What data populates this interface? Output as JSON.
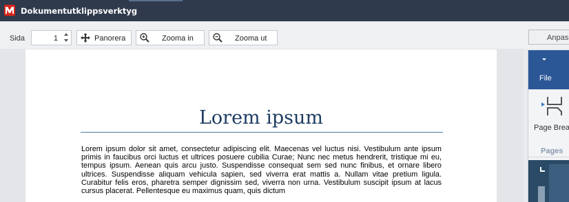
{
  "window": {
    "title": "Dokumentutklippsverktyg",
    "app_icon": "app-logo-icon",
    "accent": "#d9261c",
    "titlebar_color": "#2f3b4d"
  },
  "toolbar": {
    "page_label": "Sida",
    "page_value": "1",
    "pan_label": "Panorera",
    "zoom_in_label": "Zooma in",
    "zoom_out_label": "Zooma ut"
  },
  "document": {
    "title": "Lorem ipsum",
    "paragraph": "Lorem ipsum dolor sit amet, consectetur adipiscing elit. Maecenas vel luctus nisi. Vestibulum ante ipsum primis in faucibus orci luctus et ultrices posuere cubilia Curae; Nunc nec metus hendrerit, tristique mi eu, tempus ipsum. Aenean quis arcu justo. Suspendisse consequat sem sed nunc finibus, et ornare libero ultrices. Suspendisse aliquam vehicula sapien, sed viverra erat mattis a. Nullam vitae pretium ligula. Curabitur felis eros, pharetra semper dignissim sed, viverra non urna. Vestibulum suscipit ipsum at lacus cursus placerat. Pellentesque eu maximus quam, quis dictum",
    "title_color": "#1f3d63"
  },
  "right_panel": {
    "customize_label": "Anpass",
    "file_tab_label": "File",
    "file_tab_color": "#2b5797",
    "page_break_label": "Page Breal",
    "group_label": "Pages"
  }
}
